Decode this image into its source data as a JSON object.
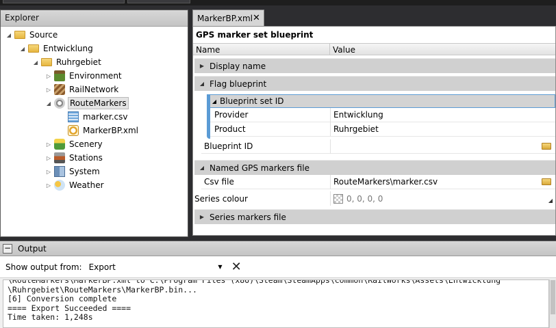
{
  "explorer": {
    "title": "Explorer",
    "nodes": [
      {
        "label": "Source",
        "icon": "folder-icon",
        "expanded": true
      },
      {
        "label": "Entwicklung",
        "icon": "folder-icon",
        "expanded": true
      },
      {
        "label": "Ruhrgebiet",
        "icon": "folder-icon",
        "expanded": true
      },
      {
        "label": "Environment",
        "icon": "environment-icon",
        "expanded": false
      },
      {
        "label": "RailNetwork",
        "icon": "railnetwork-icon",
        "expanded": false
      },
      {
        "label": "RouteMarkers",
        "icon": "routemarkers-icon",
        "expanded": true,
        "selected": true
      },
      {
        "label": "marker.csv",
        "icon": "csv-file-icon"
      },
      {
        "label": "MarkerBP.xml",
        "icon": "xml-blueprint-icon"
      },
      {
        "label": "Scenery",
        "icon": "scenery-icon",
        "expanded": false
      },
      {
        "label": "Stations",
        "icon": "stations-icon",
        "expanded": false
      },
      {
        "label": "System",
        "icon": "system-icon",
        "expanded": false
      },
      {
        "label": "Weather",
        "icon": "weather-icon",
        "expanded": false
      }
    ]
  },
  "document": {
    "tab_label": "MarkerBP.xml",
    "close_glyph": "✕",
    "title": "GPS marker set blueprint",
    "col_name": "Name",
    "col_value": "Value",
    "display_name": "Display name",
    "flag_blueprint": "Flag blueprint",
    "blueprint_set_id": "Blueprint set ID",
    "provider_label": "Provider",
    "provider_value": "Entwicklung",
    "product_label": "Product",
    "product_value": "Ruhrgebiet",
    "blueprint_id_label": "Blueprint ID",
    "named_gps": "Named GPS markers file",
    "csv_label": "Csv file",
    "csv_value": "RouteMarkers\\marker.csv",
    "series_colour_label": "Series colour",
    "series_colour_value": "0, 0, 0, 0",
    "series_markers": "Series markers file"
  },
  "output": {
    "title": "Output",
    "minimize_glyph": "−",
    "show_from_label": "Show output from:",
    "show_from_value": "Export",
    "clear_glyph": "✕",
    "lines": [
      "\\RouteMarkers\\MarkerBP.xml to C:\\Program Files (x86)\\Steam\\SteamApps\\common\\RailWorks\\Assets\\Entwicklung",
      "\\Ruhrgebiet\\RouteMarkers\\MarkerBP.bin...",
      "[6] Conversion complete",
      "==== Export Succeeded ====",
      "Time taken: 1,248s"
    ]
  }
}
